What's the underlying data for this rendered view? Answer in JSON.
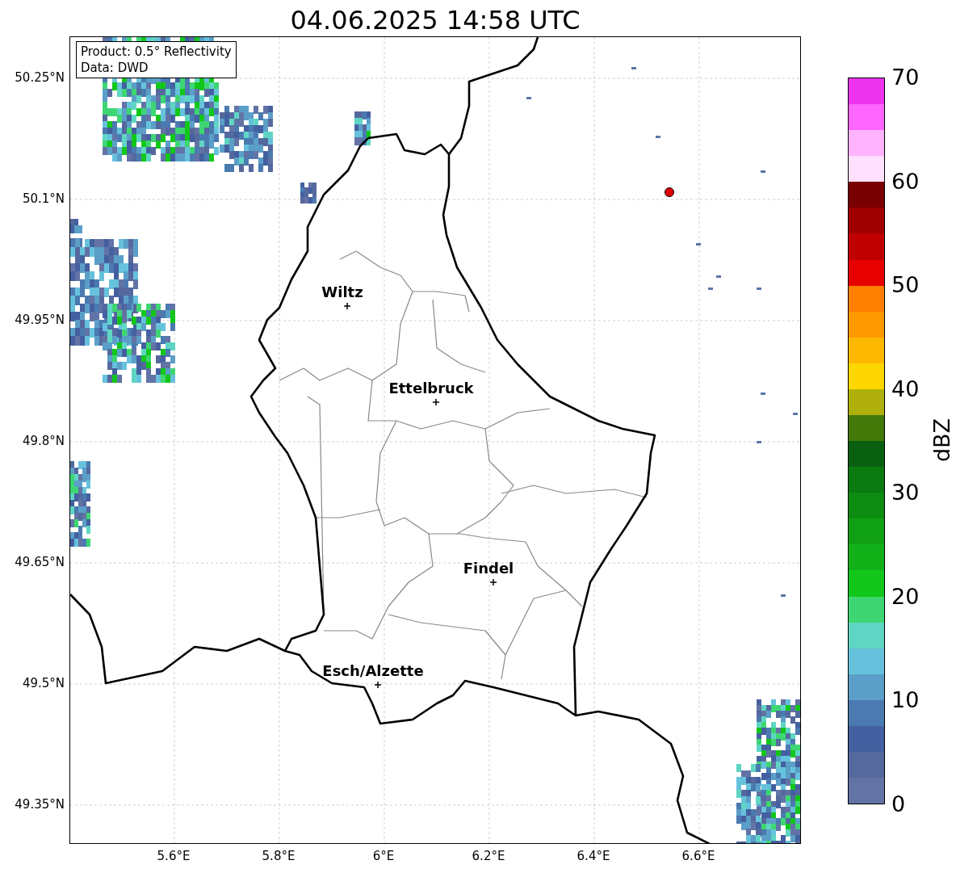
{
  "title": "04.06.2025 14:58 UTC",
  "info_box": [
    "Product: 0.5° Reflectivity",
    "Data: DWD"
  ],
  "map": {
    "y_ticks": [
      "50.25°N",
      "50.1°N",
      "49.95°N",
      "49.8°N",
      "49.65°N",
      "49.5°N",
      "49.35°N"
    ],
    "x_ticks": [
      "5.6°E",
      "5.8°E",
      "6°E",
      "6.2°E",
      "6.4°E",
      "6.6°E"
    ],
    "cities": [
      {
        "name": "Wiltz"
      },
      {
        "name": "Ettelbruck"
      },
      {
        "name": "Findel"
      },
      {
        "name": "Esch/Alzette"
      }
    ]
  },
  "colorbar": {
    "label": "dBZ",
    "ticks": [
      "70",
      "60",
      "50",
      "40",
      "30",
      "20",
      "10",
      "0"
    ],
    "bands": [
      {
        "color": "#ee33ee"
      },
      {
        "color": "#ff66ff"
      },
      {
        "color": "#ffb3ff"
      },
      {
        "color": "#ffe0ff"
      },
      {
        "color": "#780000"
      },
      {
        "color": "#a00000"
      },
      {
        "color": "#c00000"
      },
      {
        "color": "#e60000"
      },
      {
        "color": "#ff7f00"
      },
      {
        "color": "#ff9900"
      },
      {
        "color": "#ffb800"
      },
      {
        "color": "#ffd700"
      },
      {
        "color": "#b0b00c"
      },
      {
        "color": "#447a0a"
      },
      {
        "color": "#086010"
      },
      {
        "color": "#0b7a10"
      },
      {
        "color": "#0d8c12"
      },
      {
        "color": "#10a015"
      },
      {
        "color": "#12b11a"
      },
      {
        "color": "#12c71a"
      },
      {
        "color": "#3ed672"
      },
      {
        "color": "#5fd6c4"
      },
      {
        "color": "#66c2dc"
      },
      {
        "color": "#5b9fc8"
      },
      {
        "color": "#4a7ab0"
      },
      {
        "color": "#4460a0"
      },
      {
        "color": "#55699e"
      },
      {
        "color": "#6373a5"
      }
    ]
  }
}
